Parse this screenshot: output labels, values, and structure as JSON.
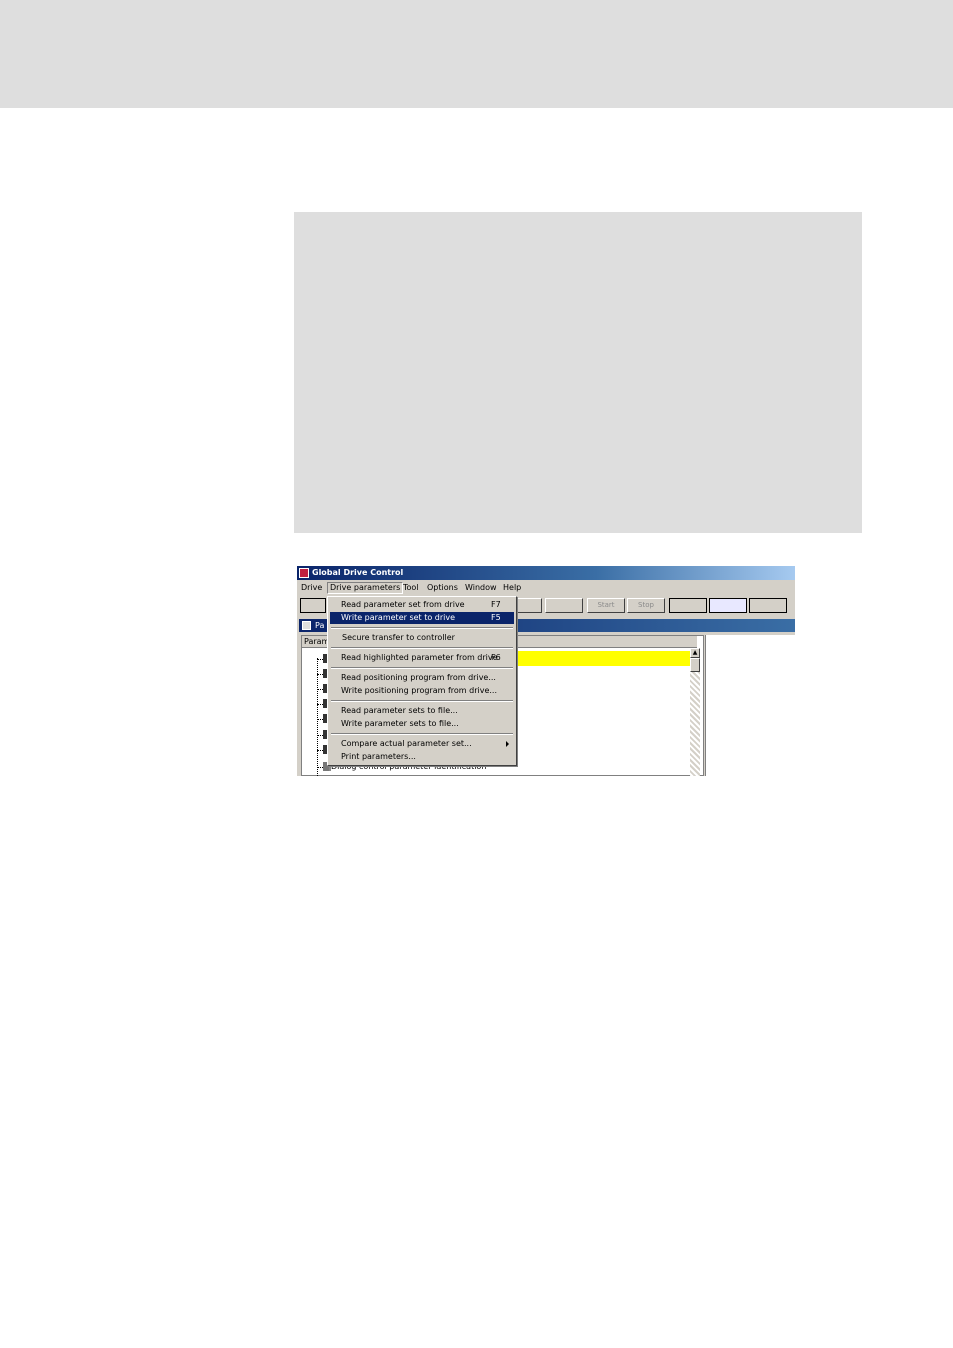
{
  "window": {
    "title": "Global Drive Control"
  },
  "menubar": [
    "Drive",
    "Drive parameters",
    "Tool",
    "Options",
    "Window",
    "Help"
  ],
  "toolbar": {
    "start_label": "Start",
    "stop_label": "Stop"
  },
  "child_window": {
    "title": "Pa"
  },
  "panel": {
    "header": "Param",
    "last_item": "Dialog control parameter identification"
  },
  "dropdown": {
    "items": [
      {
        "label": "Read parameter set from drive",
        "shortcut": "F7"
      },
      {
        "label": "Write parameter set to drive",
        "shortcut": "F5",
        "selected": true
      },
      {
        "label": "Secure transfer to controller",
        "shortcut": ""
      },
      {
        "label": "Read highlighted parameter from drive",
        "shortcut": "F6"
      },
      {
        "label": "Read positioning program from drive...",
        "shortcut": ""
      },
      {
        "label": "Write positioning program from drive...",
        "shortcut": ""
      },
      {
        "label": "Read parameter sets to file...",
        "shortcut": ""
      },
      {
        "label": "Write parameter sets to file...",
        "shortcut": ""
      },
      {
        "label": "Compare actual parameter set...",
        "shortcut": "",
        "submenu": true
      },
      {
        "label": "Print parameters...",
        "shortcut": ""
      }
    ]
  },
  "colors": {
    "selection": "#0a246a",
    "highlight": "#ffff00",
    "app_icon": "#c02040"
  }
}
